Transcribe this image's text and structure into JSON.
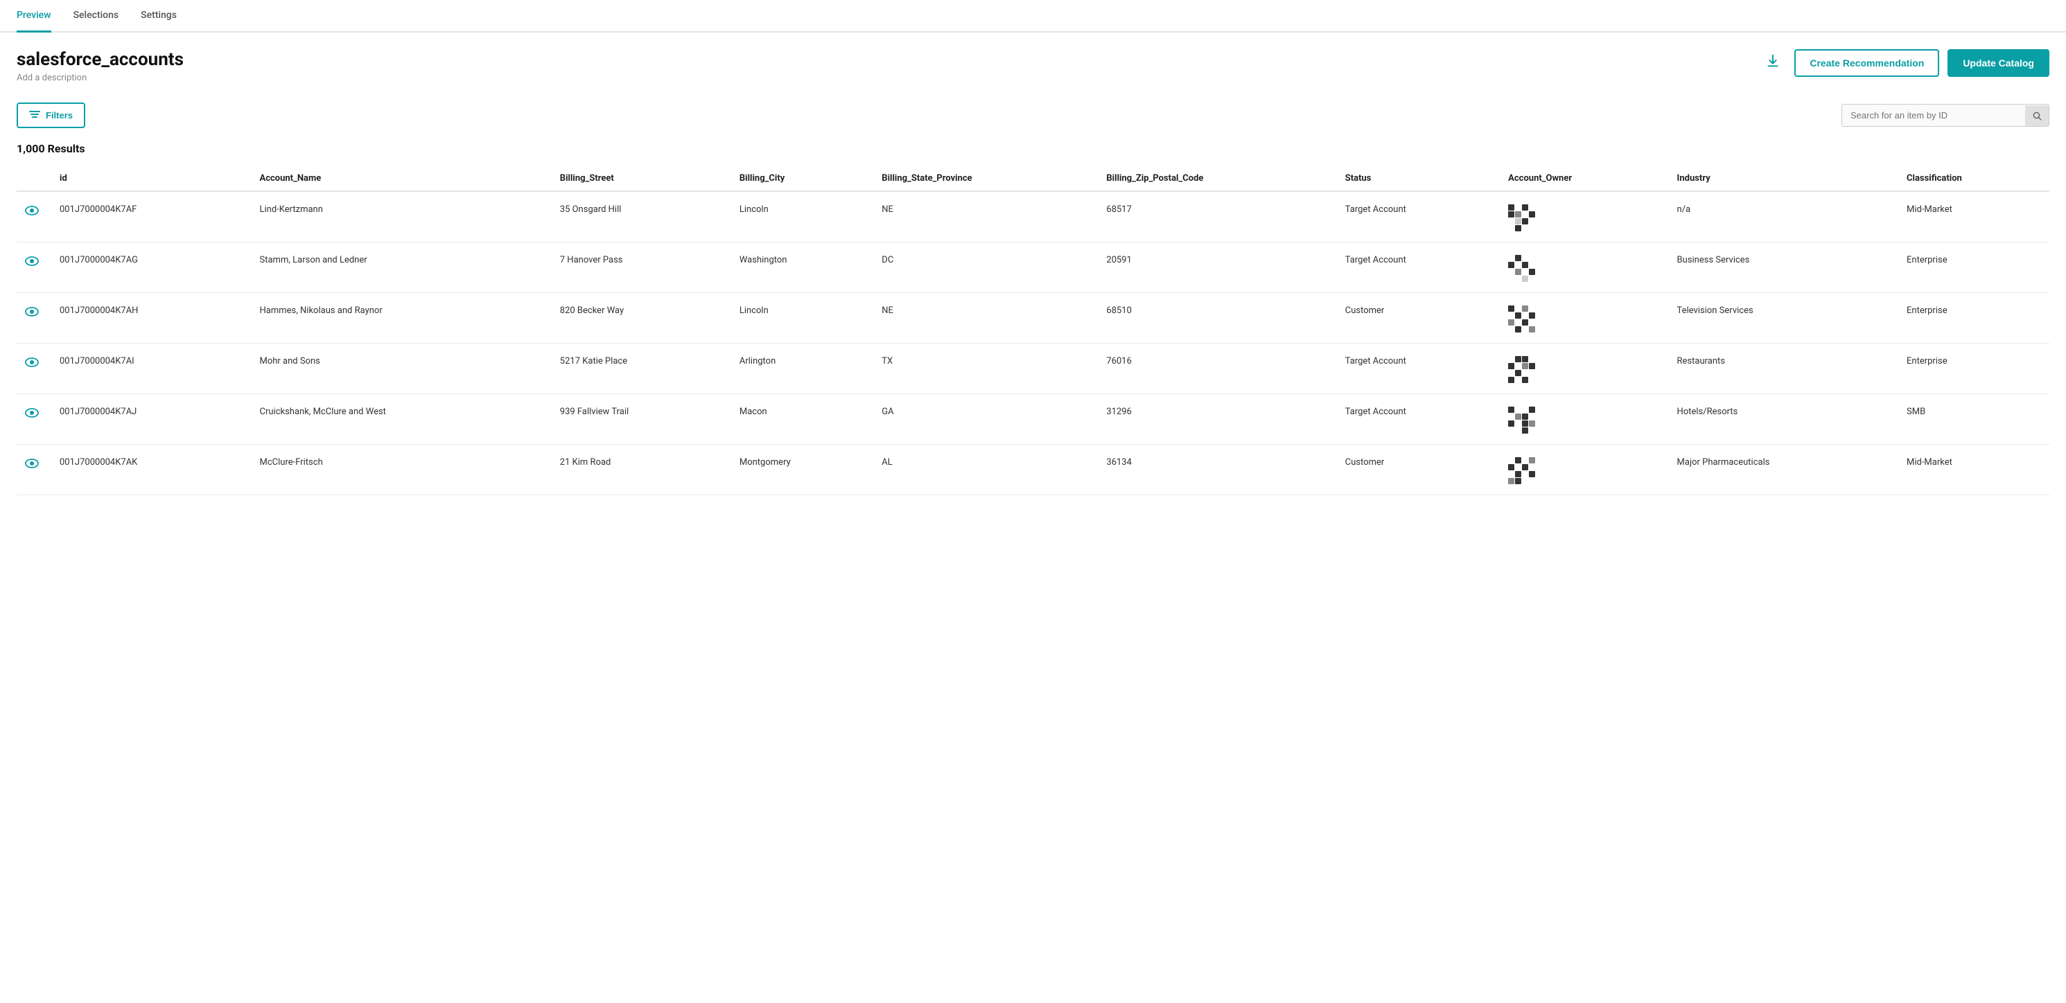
{
  "tabs": [
    {
      "label": "Preview",
      "active": true
    },
    {
      "label": "Selections",
      "active": false
    },
    {
      "label": "Settings",
      "active": false
    }
  ],
  "header": {
    "title": "salesforce_accounts",
    "description": "Add a description",
    "download_label": "⬇",
    "create_recommendation_label": "Create Recommendation",
    "update_catalog_label": "Update Catalog"
  },
  "toolbar": {
    "filters_label": "Filters",
    "search_placeholder": "Search for an item by ID"
  },
  "results": {
    "count": "1,000 Results"
  },
  "table": {
    "columns": [
      "id",
      "Account_Name",
      "Billing_Street",
      "Billing_City",
      "Billing_State_Province",
      "Billing_Zip_Postal_Code",
      "Status",
      "Account_Owner",
      "Industry",
      "Classification"
    ],
    "rows": [
      {
        "id": "001J7000004K7AF",
        "account_name": "Lind-Kertzmann",
        "billing_street": "35 Onsgard Hill",
        "billing_city": "Lincoln",
        "billing_state": "NE",
        "billing_zip": "68517",
        "status": "Target Account",
        "industry": "n/a",
        "classification": "Mid-Market"
      },
      {
        "id": "001J7000004K7AG",
        "account_name": "Stamm, Larson and Ledner",
        "billing_street": "7 Hanover Pass",
        "billing_city": "Washington",
        "billing_state": "DC",
        "billing_zip": "20591",
        "status": "Target Account",
        "industry": "Business Services",
        "classification": "Enterprise"
      },
      {
        "id": "001J7000004K7AH",
        "account_name": "Hammes, Nikolaus and Raynor",
        "billing_street": "820 Becker Way",
        "billing_city": "Lincoln",
        "billing_state": "NE",
        "billing_zip": "68510",
        "status": "Customer",
        "industry": "Television Services",
        "classification": "Enterprise"
      },
      {
        "id": "001J7000004K7AI",
        "account_name": "Mohr and Sons",
        "billing_street": "5217 Katie Place",
        "billing_city": "Arlington",
        "billing_state": "TX",
        "billing_zip": "76016",
        "status": "Target Account",
        "industry": "Restaurants",
        "classification": "Enterprise"
      },
      {
        "id": "001J7000004K7AJ",
        "account_name": "Cruickshank, McClure and West",
        "billing_street": "939 Fallview Trail",
        "billing_city": "Macon",
        "billing_state": "GA",
        "billing_zip": "31296",
        "status": "Target Account",
        "industry": "Hotels/Resorts",
        "classification": "SMB"
      },
      {
        "id": "001J7000004K7AK",
        "account_name": "McClure-Fritsch",
        "billing_street": "21 Kim Road",
        "billing_city": "Montgomery",
        "billing_state": "AL",
        "billing_zip": "36134",
        "status": "Customer",
        "industry": "Major Pharmaceuticals",
        "classification": "Mid-Market"
      }
    ]
  }
}
